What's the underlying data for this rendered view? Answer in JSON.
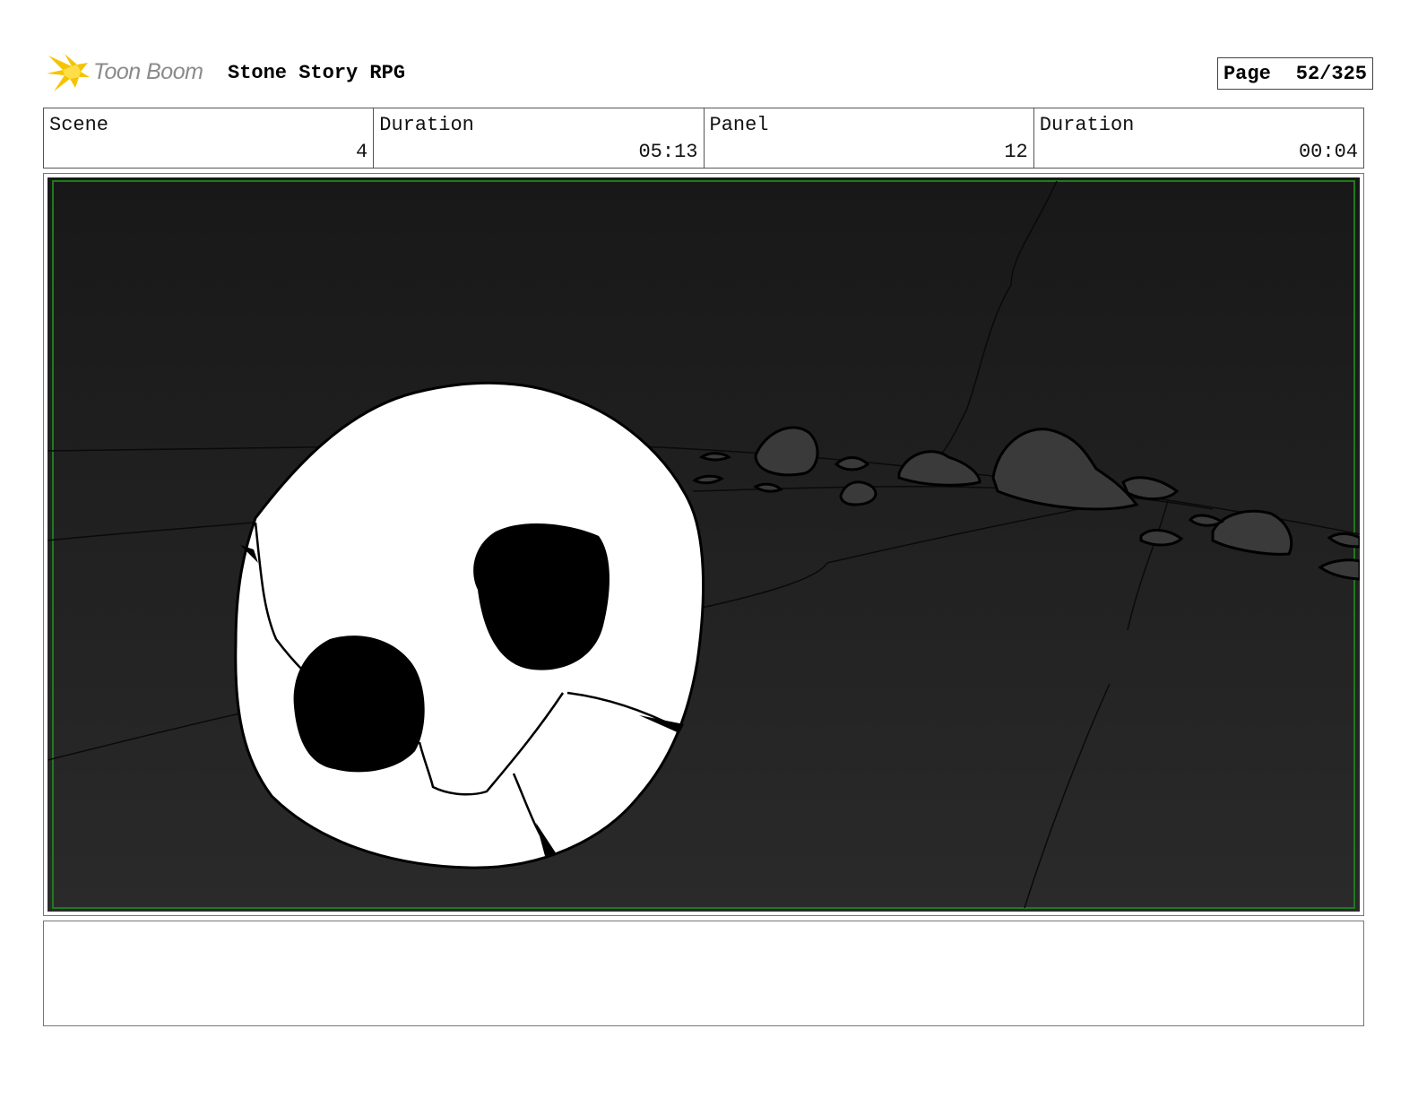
{
  "header": {
    "logo_text": "Toon Boom",
    "project_title": "Stone Story RPG",
    "page_label": "Page",
    "page_value": "52/325"
  },
  "info": [
    {
      "label": "Scene",
      "value": "4"
    },
    {
      "label": "Duration",
      "value": "05:13"
    },
    {
      "label": "Panel",
      "value": "12"
    },
    {
      "label": "Duration",
      "value": "00:04"
    }
  ],
  "panel": {
    "icon": "storyboard-drawing",
    "background_color": "#1e1e1e",
    "safe_frame_color": "#1f7a1f",
    "subject_color": "#ffffff",
    "rock_color": "#3a3a3a"
  },
  "notes": {
    "text": ""
  },
  "colors": {
    "logo_accent": "#f5c400",
    "logo_text": "#8a8a8a"
  }
}
